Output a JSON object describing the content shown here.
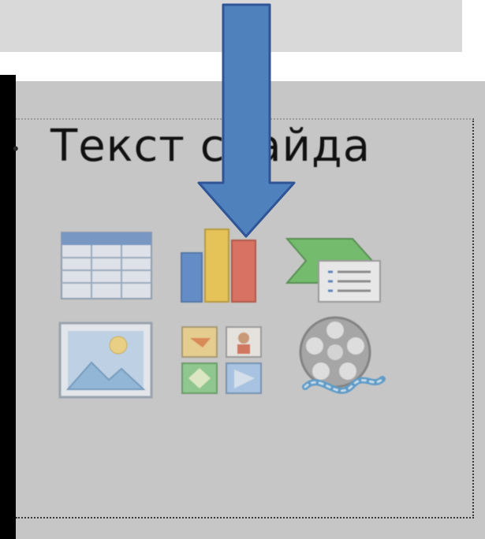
{
  "slide": {
    "title_text": "Текст слайда"
  },
  "content_icons": [
    {
      "name": "insert-table-icon"
    },
    {
      "name": "insert-chart-icon"
    },
    {
      "name": "insert-smartart-icon"
    },
    {
      "name": "insert-picture-icon"
    },
    {
      "name": "insert-clipart-icon"
    },
    {
      "name": "insert-media-icon"
    }
  ],
  "colors": {
    "arrow_fill": "#4f81bd",
    "arrow_stroke": "#2f5597",
    "panel_bg": "#c6c6c6",
    "top_strip": "#d9d9d9"
  }
}
